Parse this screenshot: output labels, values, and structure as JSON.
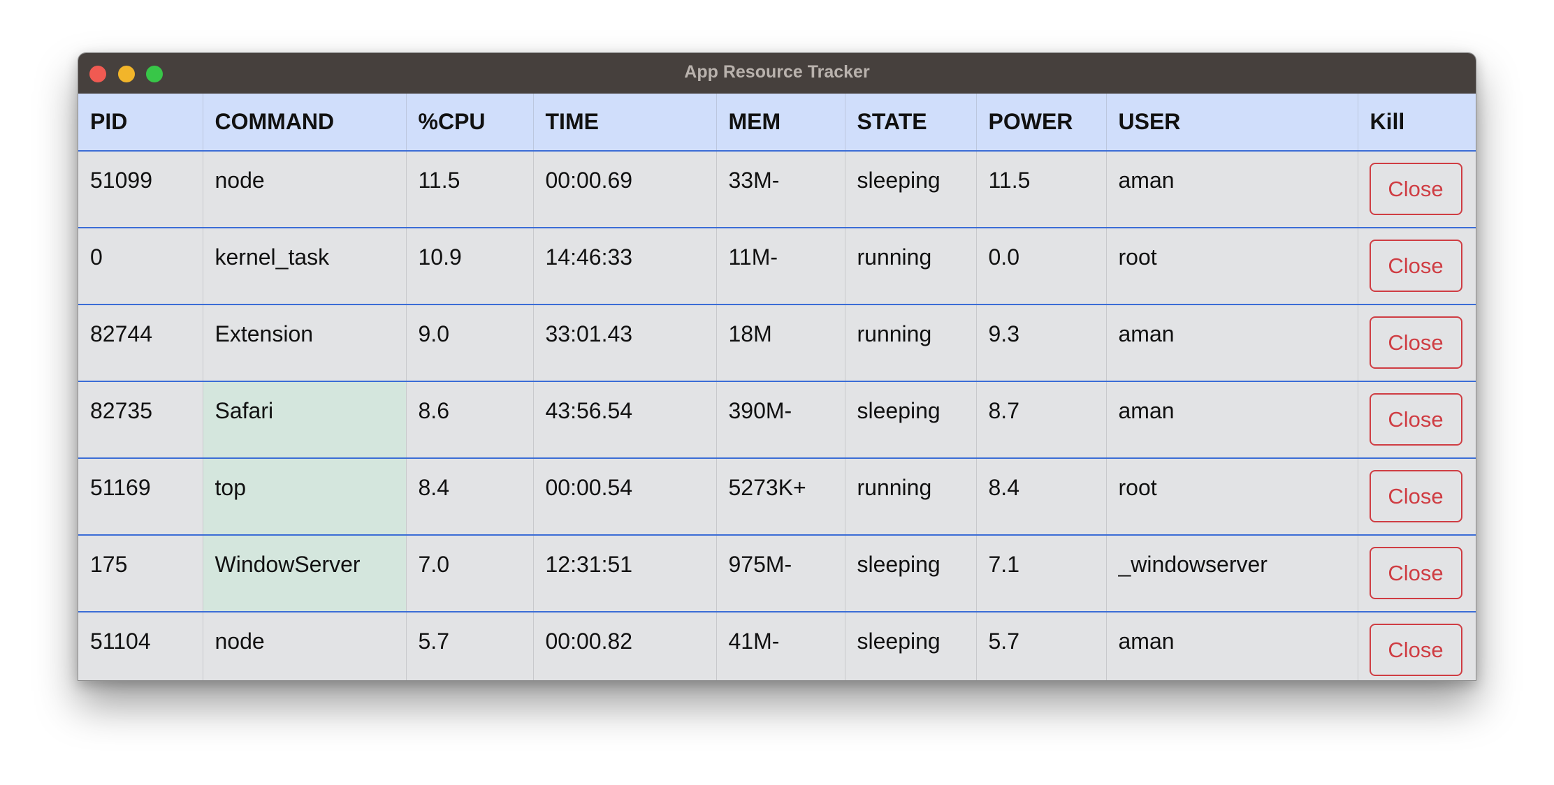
{
  "window": {
    "title": "App Resource Tracker"
  },
  "table": {
    "columns": [
      "PID",
      "COMMAND",
      "%CPU",
      "TIME",
      "MEM",
      "STATE",
      "POWER",
      "USER",
      "Kill"
    ],
    "rows": [
      {
        "pid": "51099",
        "command": "node",
        "cpu": "11.5",
        "time": "00:00.69",
        "mem": "33M-",
        "state": "sleeping",
        "power": "11.5",
        "user": "aman",
        "kill": "Close"
      },
      {
        "pid": "0",
        "command": "kernel_task",
        "cpu": "10.9",
        "time": "14:46:33",
        "mem": "11M-",
        "state": "running",
        "power": "0.0",
        "user": "root",
        "kill": "Close"
      },
      {
        "pid": "82744",
        "command": "Extension",
        "cpu": "9.0",
        "time": "33:01.43",
        "mem": "18M",
        "state": "running",
        "power": "9.3",
        "user": "aman",
        "kill": "Close"
      },
      {
        "pid": "82735",
        "command": "Safari",
        "cpu": "8.6",
        "time": "43:56.54",
        "mem": "390M-",
        "state": "sleeping",
        "power": "8.7",
        "user": "aman",
        "kill": "Close"
      },
      {
        "pid": "51169",
        "command": "top",
        "cpu": "8.4",
        "time": "00:00.54",
        "mem": "5273K+",
        "state": "running",
        "power": "8.4",
        "user": "root",
        "kill": "Close"
      },
      {
        "pid": "175",
        "command": "WindowServer",
        "cpu": "7.0",
        "time": "12:31:51",
        "mem": "975M-",
        "state": "sleeping",
        "power": "7.1",
        "user": "_windowserver",
        "kill": "Close"
      },
      {
        "pid": "51104",
        "command": "node",
        "cpu": "5.7",
        "time": "00:00.82",
        "mem": "41M-",
        "state": "sleeping",
        "power": "5.7",
        "user": "aman",
        "kill": "Close"
      }
    ]
  },
  "colors": {
    "header_bg": "#d0defb",
    "row_separator": "#3b6dd6",
    "highlight_cell": "#d4e6dd",
    "close_button": "#cf3d43",
    "titlebar": "#46403d"
  }
}
